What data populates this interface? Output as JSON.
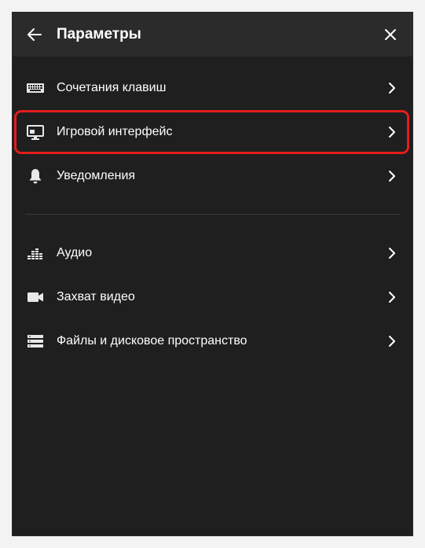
{
  "header": {
    "title": "Параметры"
  },
  "menu": {
    "items": [
      {
        "label": "Сочетания клавиш",
        "icon": "keyboard-icon"
      },
      {
        "label": "Игровой интерфейс",
        "icon": "monitor-icon",
        "highlighted": true
      },
      {
        "label": "Уведомления",
        "icon": "bell-icon"
      },
      {
        "label": "Аудио",
        "icon": "equalizer-icon"
      },
      {
        "label": "Захват видео",
        "icon": "video-camera-icon"
      },
      {
        "label": "Файлы и дисковое пространство",
        "icon": "storage-icon"
      }
    ]
  },
  "colors": {
    "panel_background": "#1f1f1f",
    "header_background": "#2b2b2b",
    "text": "#ffffff",
    "highlight_border": "#e41c1c"
  }
}
